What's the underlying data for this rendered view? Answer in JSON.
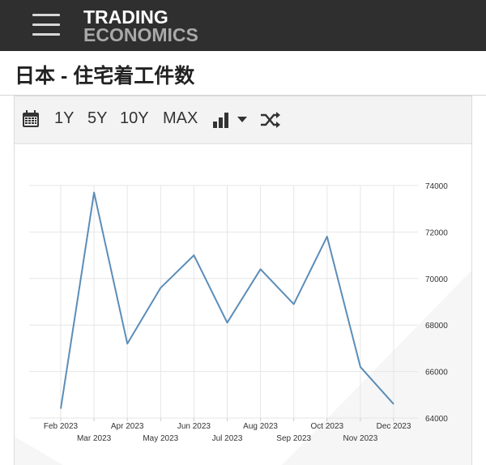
{
  "header": {
    "logo_line1": "TRADING",
    "logo_line2": "ECONOMICS",
    "menu_icon": "hamburger-icon"
  },
  "page": {
    "title": "日本 - 住宅着工件数"
  },
  "toolbar": {
    "calendar_icon": "calendar-icon",
    "ranges": [
      "1Y",
      "5Y",
      "10Y",
      "MAX"
    ],
    "chart_type_icon": "bar-chart-icon",
    "dropdown_icon": "chevron-down-icon",
    "shuffle_icon": "shuffle-icon"
  },
  "colors": {
    "line": "#5b8db8",
    "topbar": "#2f2f2f",
    "grid": "#e6e6e6",
    "watermark": "#f6f6f6"
  },
  "chart_data": {
    "type": "line",
    "x": [
      "Feb 2023",
      "Mar 2023",
      "Apr 2023",
      "May 2023",
      "Jun 2023",
      "Jul 2023",
      "Aug 2023",
      "Sep 2023",
      "Oct 2023",
      "Nov 2023",
      "Dec 2023"
    ],
    "series": [
      {
        "values": [
          64400,
          73700,
          67200,
          69600,
          71000,
          68100,
          70400,
          68900,
          71800,
          66200,
          64600
        ]
      }
    ],
    "ylim": [
      64000,
      74000
    ],
    "yticks": [
      "64000",
      "66000",
      "68000",
      "70000",
      "72000",
      "74000"
    ],
    "grid": true,
    "title": "",
    "xlabel": "",
    "ylabel": ""
  }
}
